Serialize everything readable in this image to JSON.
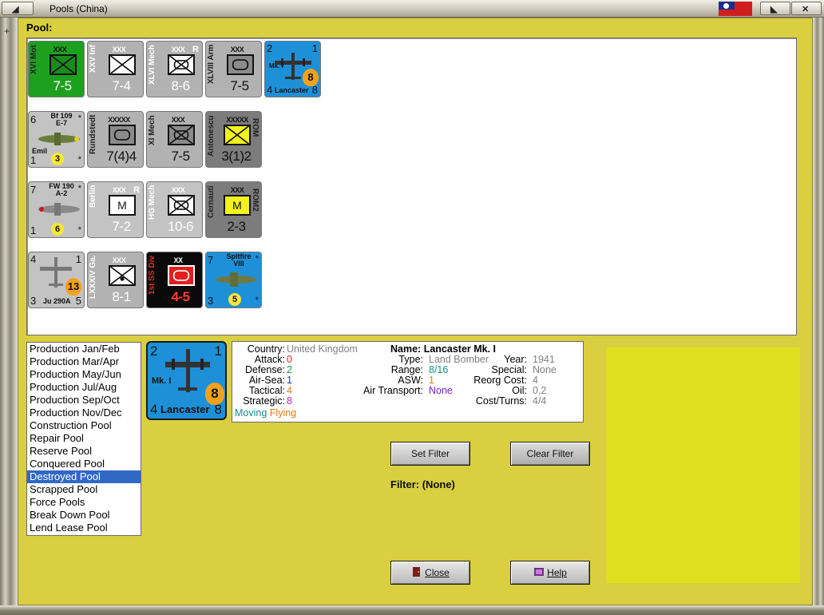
{
  "window": {
    "title": "Pools (China)"
  },
  "pool_label": "Pool:",
  "counters": [
    {
      "name": "XVI Mot",
      "size": "XXX",
      "stat": "7-5"
    },
    {
      "name": "XXV Inf",
      "size": "XXX",
      "stat": "7-4"
    },
    {
      "name": "XLVI Mech",
      "size": "XXX",
      "stat": "8-6",
      "mark": "R"
    },
    {
      "name": "XLVIII Arm",
      "size": "XXX",
      "stat": "7-5"
    },
    {
      "name": "Lancaster",
      "class": "Mk. I",
      "tl": "2",
      "tr": "1",
      "bl": "4",
      "br": "8",
      "badge": "8"
    },
    {
      "name": "Bf 109",
      "model": "E-7",
      "pilot": "Emil",
      "tl": "6",
      "bl": "1",
      "tr": "*",
      "br": "*",
      "badge": "3"
    },
    {
      "name": "Rundstedt",
      "size": "XXXXX",
      "stat": "7(4)4"
    },
    {
      "name": "XI Mech",
      "size": "XXX",
      "stat": "7-5"
    },
    {
      "name": "Antonescu",
      "size": "XXXXX",
      "stat": "3(1)2",
      "side": "ROM"
    },
    {
      "name": "FW 190",
      "model": "A-2",
      "tl": "7",
      "bl": "1",
      "tr": "*",
      "br": "*",
      "badge": "6"
    },
    {
      "name": "Berlin",
      "size": "XXX",
      "stat": "7-2",
      "mark": "R",
      "letter": "M"
    },
    {
      "name": "HG Mech",
      "size": "XXX",
      "stat": "10-6"
    },
    {
      "name": "Cernauti",
      "size": "XXX",
      "stat": "2-3",
      "side": "ROM2",
      "letter": "M"
    },
    {
      "name": "Ju 290A",
      "tl": "4",
      "tr": "1",
      "bl": "3",
      "br": "5",
      "badge": "13"
    },
    {
      "name": "LXXXIV Ga.",
      "size": "XXX",
      "stat": "8-1"
    },
    {
      "name": "1st SS Div",
      "size": "XX",
      "stat": "4-5"
    },
    {
      "name": "Spitfire",
      "model": "VIII",
      "tl": "7",
      "bl": "3",
      "tr": "*",
      "br": "*",
      "badge": "5"
    }
  ],
  "pool_list": [
    "Production Jan/Feb",
    "Production Mar/Apr",
    "Production May/Jun",
    "Production Jul/Aug",
    "Production Sep/Oct",
    "Production Nov/Dec",
    "Construction Pool",
    "Repair Pool",
    "Reserve Pool",
    "Conquered Pool",
    "Destroyed Pool",
    "Scrapped Pool",
    "Force Pools",
    "Break Down Pool",
    "Lend Lease Pool"
  ],
  "selected_pool": "Destroyed Pool",
  "detail": {
    "counter": {
      "tl": "2",
      "tr": "1",
      "bl": "4",
      "br": "8",
      "class": "Mk. I",
      "name": "Lancaster",
      "badge": "8"
    },
    "country_label": "Country:",
    "country": "United Kingdom",
    "attack_label": "Attack:",
    "attack": "0",
    "defense_label": "Defense:",
    "defense": "2",
    "airsea_label": "Air-Sea:",
    "airsea": "1",
    "tactical_label": "Tactical:",
    "tactical": "4",
    "strategic_label": "Strategic:",
    "strategic": "8",
    "moving": "Moving",
    "flying": "Flying",
    "name_label": "Name:",
    "name": "Lancaster Mk. I",
    "type_label": "Type:",
    "type": "Land Bomber",
    "year_label": "Year:",
    "year": "1941",
    "range_label": "Range:",
    "range": "8/16",
    "special_label": "Special:",
    "special": "None",
    "asw_label": "ASW:",
    "asw": "1",
    "reorg_label": "Reorg Cost:",
    "reorg": "4",
    "airtransport_label": "Air Transport:",
    "airtransport": "None",
    "oil_label": "Oil:",
    "oil": "0,2",
    "costturns_label": "Cost/Turns:",
    "costturns": "4/4"
  },
  "buttons": {
    "set_filter": "Set Filter",
    "clear_filter": "Clear Filter",
    "close": "Close",
    "help": "Help"
  },
  "filter_text": "Filter: (None)",
  "colors": {
    "background": "#d9cf40",
    "selected": "#3168c6",
    "air_blue": "#1e90d8",
    "green_unit": "#1ea01f"
  }
}
